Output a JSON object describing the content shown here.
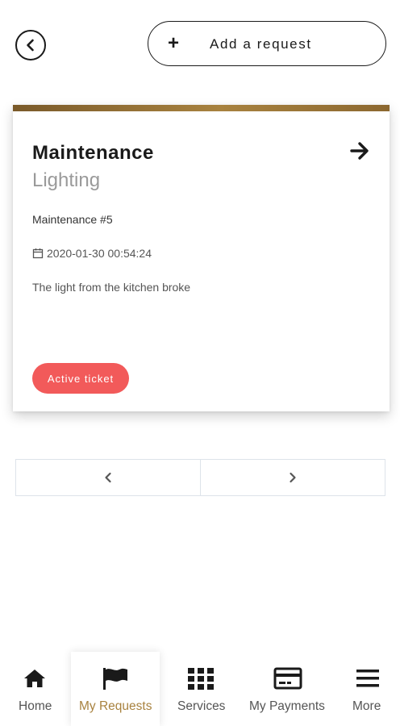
{
  "header": {
    "back_icon": "chevron-left-icon",
    "add_request_icon": "plus-icon",
    "add_request_symbol": "+",
    "add_request_label": "Add a request"
  },
  "request_card": {
    "title": "Maintenance",
    "subtitle": "Lighting",
    "reference": "Maintenance #5",
    "date": "2020-01-30 00:54:24",
    "description": "The light from the kitchen broke",
    "status": "Active ticket",
    "status_color": "#f25a5a",
    "accent_color": "#a8823f"
  },
  "pagination": {
    "prev_icon": "chevron-left-icon",
    "next_icon": "chevron-right-icon"
  },
  "tabbar": {
    "active_color": "#a8823f",
    "tabs": [
      {
        "label": "Home",
        "icon": "home-icon"
      },
      {
        "label": "My Requests",
        "icon": "flag-icon",
        "active": true
      },
      {
        "label": "Services",
        "icon": "grid-icon"
      },
      {
        "label": "My Payments",
        "icon": "credit-card-icon"
      },
      {
        "label": "More",
        "icon": "menu-icon"
      }
    ]
  }
}
